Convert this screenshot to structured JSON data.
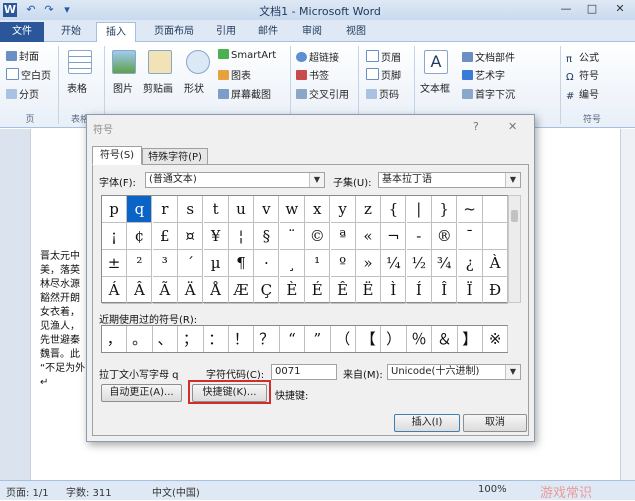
{
  "window": {
    "title": "文档1 - Microsoft Word",
    "minimize": "—",
    "maximize": "□",
    "close": "✕"
  },
  "quick_access": [
    "W",
    "↶",
    "↷",
    "▾"
  ],
  "tabs": [
    "文件",
    "开始",
    "插入",
    "页面布局",
    "引用",
    "邮件",
    "审阅",
    "视图"
  ],
  "ribbon": {
    "pages_group": {
      "cover": "封面",
      "blank": "空白页",
      "break": "分页",
      "label": "页"
    },
    "table": {
      "label": "表格",
      "group": "表格"
    },
    "illustrations": {
      "picture": "图片",
      "clipart": "剪贴画",
      "shapes": "形状",
      "smartart": "SmartArt",
      "chart": "图表",
      "screenshot": "屏幕截图"
    },
    "links": {
      "hyperlink": "超链接",
      "bookmark": "书签",
      "crossref": "交叉引用"
    },
    "header_footer": {
      "header": "页眉",
      "footer": "页脚",
      "page_number": "页码"
    },
    "text": {
      "textbox": "文本框",
      "quickparts": "文档部件",
      "wordart": "艺术字",
      "dropcap": "首字下沉"
    },
    "symbols": {
      "equation": "公式",
      "symbol": "符号",
      "number": "编号",
      "label": "符号"
    }
  },
  "document_lines": [
    "晋太元中",
    "美，落英",
    "林尽水源",
    "豁然开朗",
    "女衣着，",
    "见渔人，",
    "先世避秦",
    "魏晋。此",
    "“不足为外",
    "↵"
  ],
  "dialog": {
    "title": "符号",
    "help": "?",
    "close": "✕",
    "tabs": [
      "符号(S)",
      "特殊字符(P)"
    ],
    "font_label": "字体(F):",
    "font_value": "(普通文本)",
    "subset_label": "子集(U):",
    "subset_value": "基本拉丁语",
    "symbols": [
      [
        "p",
        "q",
        "r",
        "s",
        "t",
        "u",
        "v",
        "w",
        "x",
        "y",
        "z",
        "{",
        "|",
        "}",
        "~",
        ""
      ],
      [
        "¡",
        "¢",
        "£",
        "¤",
        "¥",
        "¦",
        "§",
        "¨",
        "©",
        "ª",
        "«",
        "¬",
        "-",
        "®",
        "¯",
        ""
      ],
      [
        "±",
        "²",
        "³",
        "´",
        "µ",
        "¶",
        "·",
        "¸",
        "¹",
        "º",
        "»",
        "¼",
        "½",
        "¾",
        "¿",
        "À"
      ],
      [
        "Á",
        "Â",
        "Ã",
        "Ä",
        "Å",
        "Æ",
        "Ç",
        "È",
        "É",
        "Ê",
        "Ë",
        "Ì",
        "Í",
        "Î",
        "Ï",
        "Ð"
      ]
    ],
    "recent_label": "近期使用过的符号(R):",
    "recent_symbols": [
      "，",
      "。",
      "、",
      "；",
      "：",
      "！",
      "？",
      "“",
      "”",
      "（",
      "【",
      "）",
      "％",
      "＆",
      "】",
      "※"
    ],
    "char_name": "拉丁文小写字母 q",
    "char_code_label": "字符代码(C):",
    "char_code_value": "0071",
    "from_label": "来自(M):",
    "from_value": "Unicode(十六进制)",
    "autocorrect_button": "自动更正(A)...",
    "shortcut_button": "快捷键(K)...",
    "shortcut_label": "快捷键:",
    "insert_button": "插入(I)",
    "cancel_button": "取消"
  },
  "status": {
    "page": "页面: 1/1",
    "words": "字数: 311",
    "language": "中文(中国)",
    "zoom": "100%",
    "watermark": "游戏常识"
  }
}
